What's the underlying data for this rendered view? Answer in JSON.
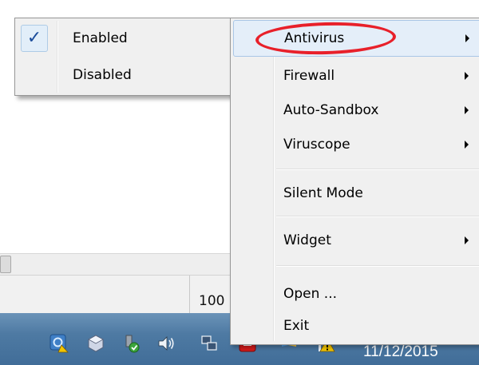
{
  "submenu": {
    "items": [
      {
        "label": "Enabled",
        "checked": true
      },
      {
        "label": "Disabled",
        "checked": false
      }
    ],
    "check_glyph": "✓"
  },
  "context_menu": {
    "items": [
      {
        "label": "Antivirus",
        "has_submenu": true,
        "highlighted": true
      },
      {
        "label": "Firewall",
        "has_submenu": true
      },
      {
        "label": "Auto-Sandbox",
        "has_submenu": true
      },
      {
        "label": "Viruscope",
        "has_submenu": true
      },
      {
        "label": "Silent Mode",
        "has_submenu": false
      },
      {
        "label": "Widget",
        "has_submenu": true
      },
      {
        "label": "Open ...",
        "has_submenu": false
      },
      {
        "label": "Exit",
        "has_submenu": false
      }
    ]
  },
  "status_bar": {
    "zoom": "100"
  },
  "taskbar": {
    "clock": "11/12/2015",
    "tray_icons": [
      "security-shield-icon",
      "virtualbox-icon",
      "usb-safely-remove-icon",
      "speaker-icon",
      "network-icon",
      "red-app-icon",
      "flag-icon",
      "warning-icon"
    ]
  },
  "colors": {
    "menu_bg": "#f0f0f0",
    "highlight_bg": "#e4eef9",
    "annotation": "#e8202a",
    "taskbar": "#4e7aa3"
  }
}
